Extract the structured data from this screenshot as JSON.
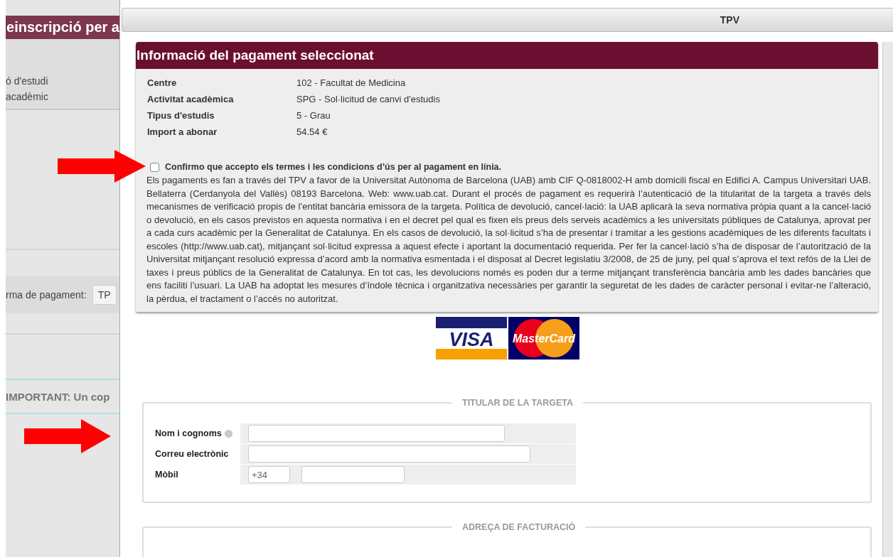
{
  "background": {
    "header_title": "einscripció per a",
    "items": [
      "ó d'estudi",
      "acadèmic"
    ],
    "payment_label": "rma de pagament:",
    "payment_value": "TP",
    "notice": "IMPORTANT: Un cop"
  },
  "modal": {
    "title": "TPV",
    "info": {
      "title": "Informació del pagament seleccionat",
      "rows": [
        {
          "label": "Centre",
          "value": "102 - Facultat de Medicina"
        },
        {
          "label": "Activitat acadèmica",
          "value": "SPG - Sol·licitud de canvi d'estudis"
        },
        {
          "label": "Tipus d'estudis",
          "value": "5 - Grau"
        },
        {
          "label": "Import a abonar",
          "value": "54.54 €"
        }
      ],
      "terms": {
        "label": "Confirmo que accepto els termes i les condicions d’ús per al pagament en línia.",
        "checked": false
      },
      "legal_text": "Els pagaments es fan a través del TPV a favor de la Universitat Autònoma de Barcelona (UAB) amb CIF Q-0818002-H amb domicili fiscal en Edifici A. Campus Universitari UAB. Bellaterra (Cerdanyola del Vallès) 08193 Barcelona. Web: www.uab.cat. Durant el procés de pagament es requerirà l’autenticació de la titularitat de la targeta a través dels mecanismes de verificació propis de l’entitat bancària emissora de la targeta. Política de devolució, cancel·lació: la UAB aplicarà la seva normativa pròpia quant a la cancel·lació o devolució, en els casos previstos en aquesta normativa i en el decret pel qual es fixen els preus dels serveis acadèmics a les universitats públiques de Catalunya, aprovat per a cada curs acadèmic per la Generalitat de Catalunya. En els casos de devolució, la sol·licitud s’ha de presentar i tramitar a les gestions acadèmiques de les diferents facultats i escoles (http://www.uab.cat), mitjançant sol·licitud expressa a aquest efecte i aportant la documentació requerida. Per fer la cancel·lació s’ha de disposar de l’autorització de la Universitat mitjançant resolució expressa d’acord amb la normativa esmentada i el disposat al Decret legislatiu 3/2008, de 25 de juny, pel qual s’aprova el text refós de la Llei de taxes i preus públics de la Generalitat de Catalunya. En tot cas, les devolucions només es poden dur a terme mitjançant transferència bancària amb les dades bancàries que ens faciliti l’usuari. La UAB ha adoptat les mesures d’índole tècnica i organitzativa necessàries per garantir la seguretat de les dades de caràcter personal i evitar-ne l’alteració, la pèrdua, el tractament o l’accés no autoritzat."
    },
    "card_logos": [
      {
        "kind": "visa",
        "text": "VISA"
      },
      {
        "kind": "mastercard",
        "text": "MasterCard"
      }
    ],
    "cardholder": {
      "legend": "TITULAR DE LA TARGETA",
      "fields": [
        {
          "label": "Nom i cognoms",
          "kind": "text",
          "info_icon": true
        },
        {
          "label": "Correu electrònic",
          "kind": "email",
          "info_icon": false
        },
        {
          "label": "Mòbil",
          "kind": "phone",
          "prefix": "+34",
          "info_icon": false
        }
      ]
    },
    "billing": {
      "legend": "ADREÇA DE FACTURACIÓ"
    }
  }
}
